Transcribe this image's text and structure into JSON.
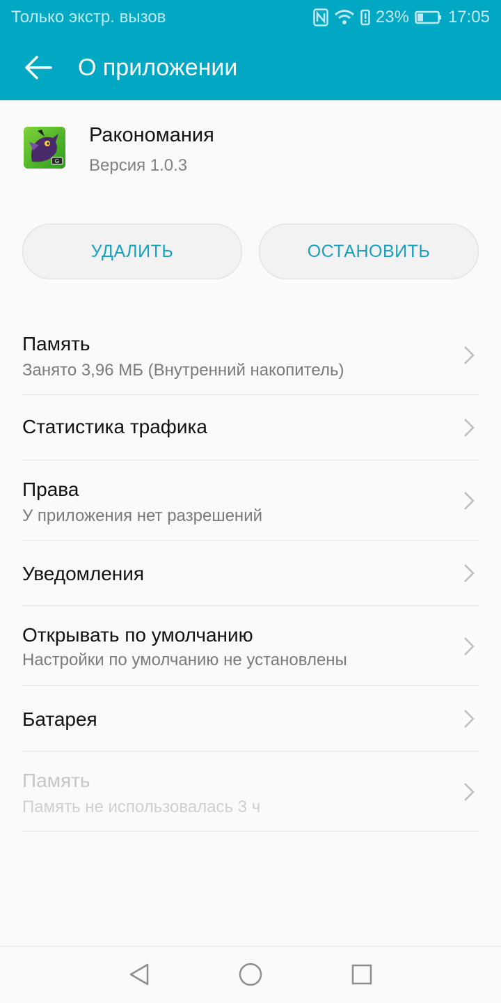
{
  "status_bar": {
    "carrier_text": "Только экстр. вызов",
    "battery_percent": "23%",
    "time": "17:05",
    "icons": [
      "nfc-icon",
      "wifi-icon",
      "battery-alert-icon",
      "battery-icon"
    ]
  },
  "app_bar": {
    "title": "О приложении",
    "back_icon": "arrow-back-icon"
  },
  "app": {
    "name": "Ракономания",
    "version": "Версия 1.0.3"
  },
  "buttons": {
    "uninstall": "УДАЛИТЬ",
    "stop": "ОСТАНОВИТЬ"
  },
  "settings": [
    {
      "title": "Память",
      "subtitle": "Занято 3,96 МБ (Внутренний накопитель)"
    },
    {
      "title": "Статистика трафика"
    },
    {
      "title": "Права",
      "subtitle": "У приложения нет разрешений"
    },
    {
      "title": "Уведомления"
    },
    {
      "title": "Открывать по умолчанию",
      "subtitle": "Настройки по умолчанию не установлены"
    },
    {
      "title": "Батарея"
    },
    {
      "title": "Память",
      "subtitle": "Память не использовалась 3 ч"
    }
  ],
  "nav_bar": {
    "icons": [
      "nav-back-icon",
      "nav-home-icon",
      "nav-recents-icon"
    ]
  },
  "colors": {
    "accent": "#00a8c4",
    "button_text": "#17a1be",
    "background": "#fafafa"
  }
}
